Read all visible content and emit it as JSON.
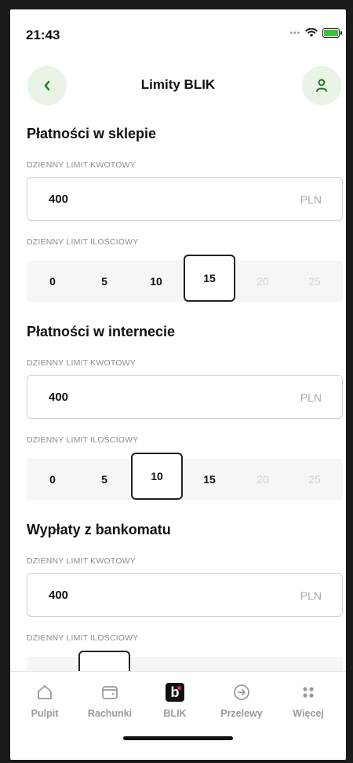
{
  "status": {
    "time": "21:43"
  },
  "header": {
    "title": "Limity BLIK"
  },
  "sections": [
    {
      "title": "Płatności w sklepie",
      "amount_label": "DZIENNY LIMIT KWOTOWY",
      "amount_value": "400",
      "currency": "PLN",
      "count_label": "DZIENNY LIMIT ILOŚCIOWY",
      "options": [
        "0",
        "5",
        "10",
        "15",
        "20",
        "25"
      ],
      "selected": "15"
    },
    {
      "title": "Płatności w internecie",
      "amount_label": "DZIENNY LIMIT KWOTOWY",
      "amount_value": "400",
      "currency": "PLN",
      "count_label": "DZIENNY LIMIT ILOŚCIOWY",
      "options": [
        "0",
        "5",
        "10",
        "15",
        "20",
        "25"
      ],
      "selected": "10"
    },
    {
      "title": "Wypłaty z bankomatu",
      "amount_label": "DZIENNY LIMIT KWOTOWY",
      "amount_value": "400",
      "currency": "PLN",
      "count_label": "DZIENNY LIMIT ILOŚCIOWY"
    }
  ],
  "tabs": [
    {
      "label": "Pulpit",
      "icon": "home-icon"
    },
    {
      "label": "Rachunki",
      "icon": "wallet-icon"
    },
    {
      "label": "BLIK",
      "icon": "blik-icon"
    },
    {
      "label": "Przelewy",
      "icon": "transfer-icon"
    },
    {
      "label": "Więcej",
      "icon": "more-icon"
    }
  ],
  "colors": {
    "accent": "#2e8b2e",
    "accent_bg": "#eaf4e6",
    "selected_border": "#222222"
  }
}
